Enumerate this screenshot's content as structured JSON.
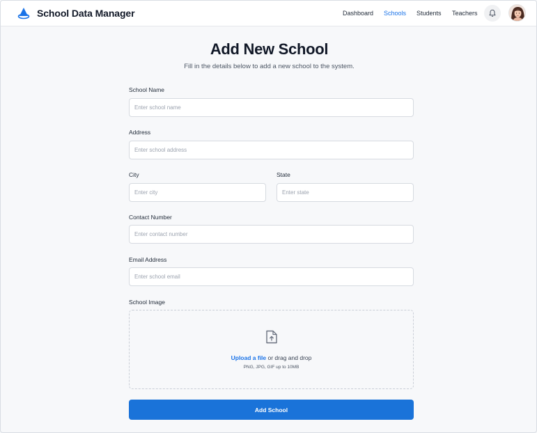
{
  "app": {
    "title": "School Data Manager"
  },
  "nav": {
    "items": [
      {
        "label": "Dashboard",
        "active": false
      },
      {
        "label": "Schools",
        "active": true
      },
      {
        "label": "Students",
        "active": false
      },
      {
        "label": "Teachers",
        "active": false
      }
    ],
    "notification_icon": "bell-icon",
    "avatar_icon": "user-avatar"
  },
  "page": {
    "title": "Add New School",
    "subtitle": "Fill in the details below to add a new school to the system."
  },
  "form": {
    "school_name": {
      "label": "School Name",
      "placeholder": "Enter school name",
      "value": ""
    },
    "address": {
      "label": "Address",
      "placeholder": "Enter school address",
      "value": ""
    },
    "city": {
      "label": "City",
      "placeholder": "Enter city",
      "value": ""
    },
    "state": {
      "label": "State",
      "placeholder": "Enter state",
      "value": ""
    },
    "contact": {
      "label": "Contact Number",
      "placeholder": "Enter contact number",
      "value": ""
    },
    "email": {
      "label": "Email Address",
      "placeholder": "Enter school email",
      "value": ""
    },
    "image": {
      "label": "School Image",
      "upload_link": "Upload a file",
      "upload_text": " or drag and drop",
      "hint": "PNG, JPG, GIF up to 10MB",
      "icon": "file-upload-icon"
    },
    "submit_label": "Add School"
  },
  "colors": {
    "accent": "#1a73d9",
    "link": "#1a73e8",
    "background": "#f7f8fa",
    "text": "#111827"
  }
}
